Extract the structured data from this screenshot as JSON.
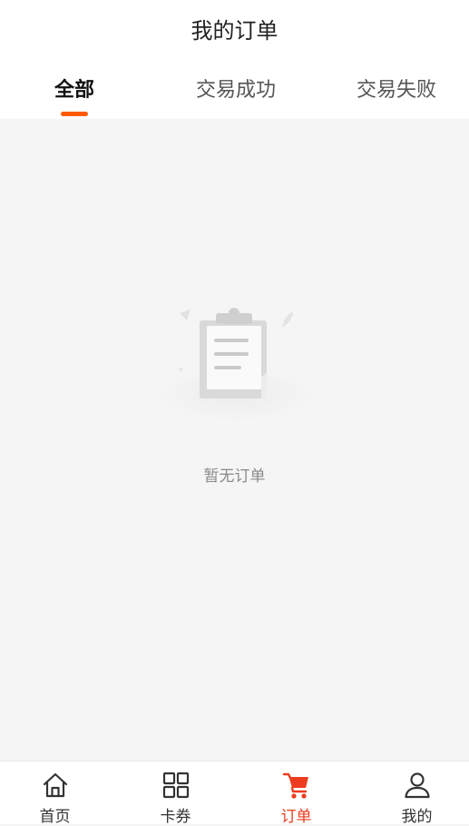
{
  "header": {
    "title": "我的订单"
  },
  "tabs": [
    {
      "label": "全部",
      "active": true
    },
    {
      "label": "交易成功",
      "active": false
    },
    {
      "label": "交易失败",
      "active": false
    }
  ],
  "empty_state": {
    "message": "暂无订单",
    "icon": "clipboard-empty-icon"
  },
  "tabbar": {
    "items": [
      {
        "label": "首页",
        "icon": "home-icon",
        "active": false
      },
      {
        "label": "卡券",
        "icon": "grid-icon",
        "active": false
      },
      {
        "label": "订单",
        "icon": "cart-icon",
        "active": true
      },
      {
        "label": "我的",
        "icon": "user-icon",
        "active": false
      }
    ]
  },
  "colors": {
    "accent": "#ff5a00",
    "active_tab_icon": "#ee3b1f",
    "background": "#f5f5f5"
  }
}
